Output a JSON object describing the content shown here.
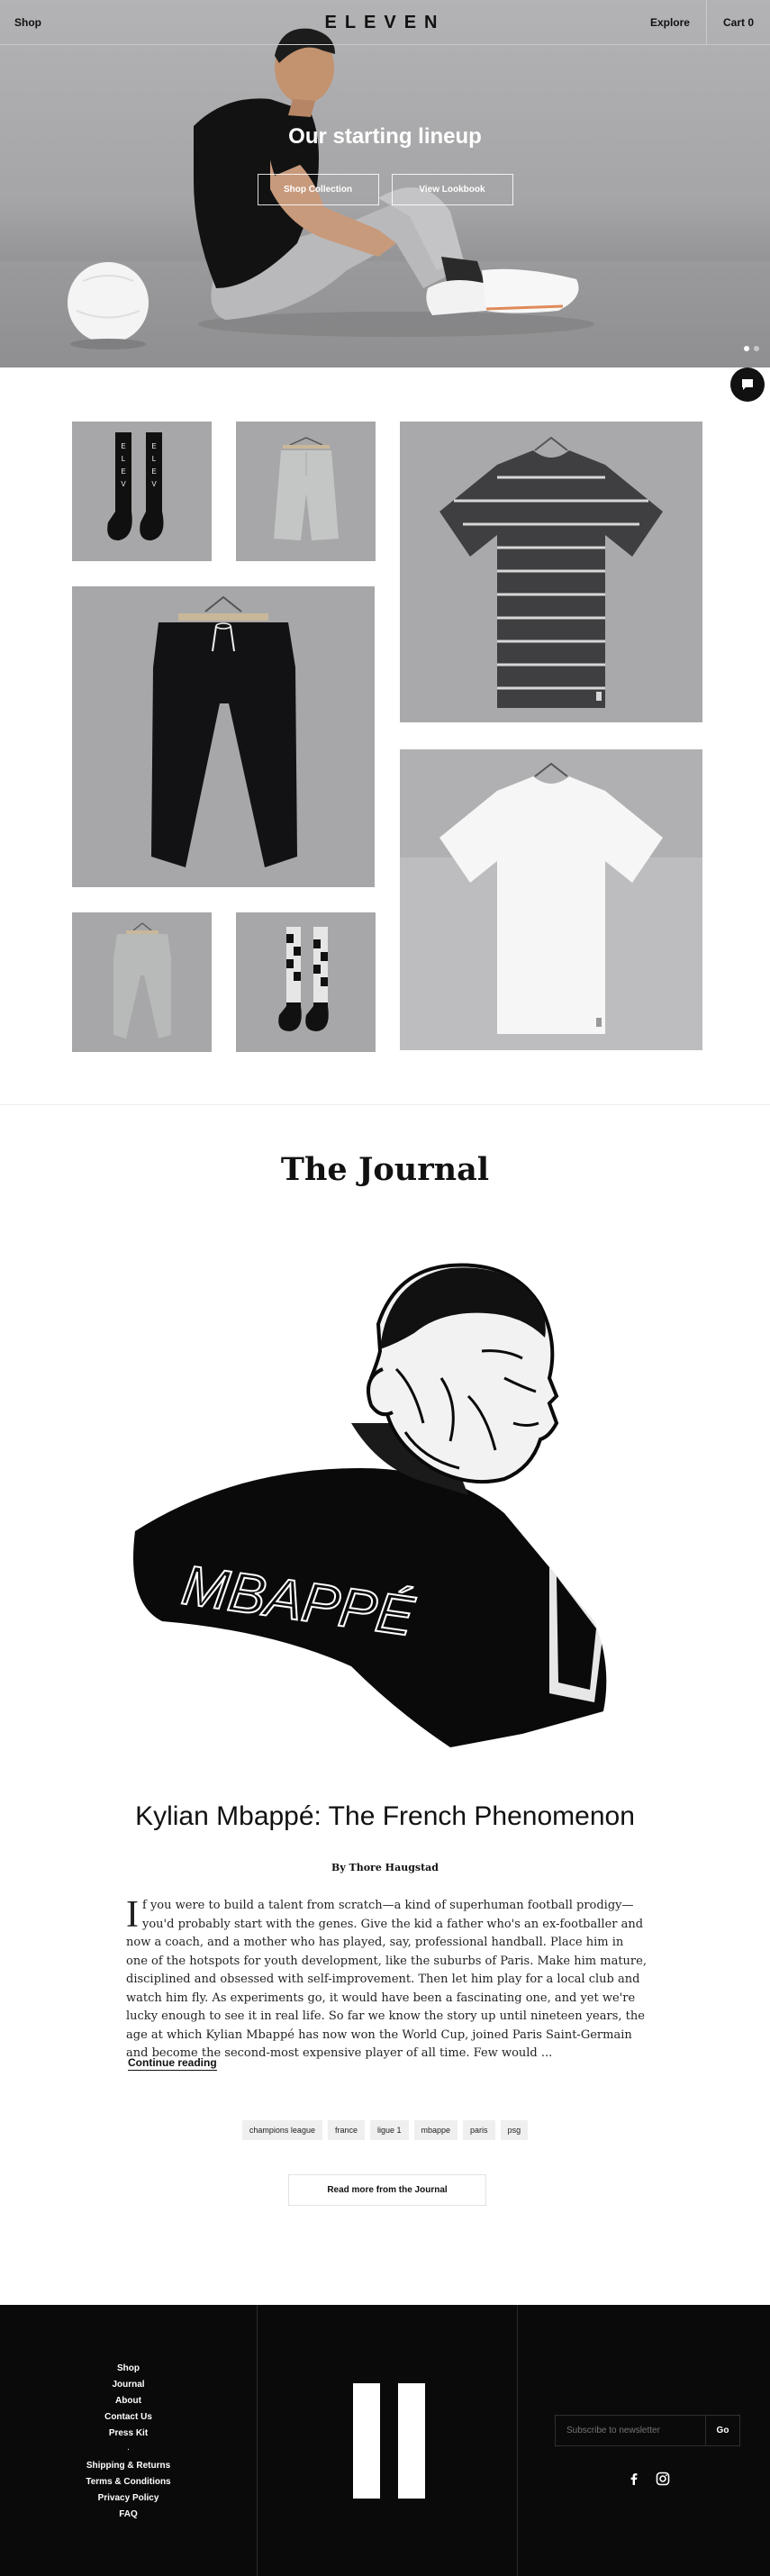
{
  "header": {
    "shop_label": "Shop",
    "logo_text": "ELEVEN",
    "explore_label": "Explore",
    "cart_label": "Cart 0"
  },
  "hero": {
    "title": "Our starting lineup",
    "shop_button": "Shop Collection",
    "lookbook_button": "View Lookbook",
    "slide_count": 2,
    "active_slide": 1
  },
  "products": [
    {
      "name": "Eleven socks black"
    },
    {
      "name": "Grey shorts"
    },
    {
      "name": "Striped t-shirt"
    },
    {
      "name": "Black joggers"
    },
    {
      "name": "White t-shirt"
    },
    {
      "name": "Grey joggers"
    },
    {
      "name": "Pixel socks"
    }
  ],
  "journal": {
    "heading": "The Journal",
    "illustration_text": "MBAPPÉ",
    "article_title": "Kylian Mbappé: The French Phenomenon",
    "byline": "By Thore Haugstad",
    "excerpt_first_letter": "I",
    "excerpt_rest": "f you were to build a talent from scratch—a kind of superhuman football prodigy—you'd probably start with the genes. Give the kid a father who's an ex-footballer and now a coach, and a mother who has played, say, professional handball. Place him in one of the hotspots for youth development, like the suburbs of Paris. Make him mature, disciplined and obsessed with self-improvement. Then let him play for a local club and watch him fly. As experiments go, it would have been a fascinating one, and yet we're lucky enough to see it in real life. So far we know the story up until nineteen years, the age at which Kylian Mbappé has now won the World Cup, joined Paris Saint-Germain and become the second-most expensive player of all time. Few would ...",
    "continue_label": "Continue reading",
    "tags": [
      "champions league",
      "france",
      "ligue 1",
      "mbappe",
      "paris",
      "psg"
    ],
    "read_more_label": "Read more from the Journal"
  },
  "footer": {
    "links": [
      "Shop",
      "Journal",
      "About",
      "Contact Us",
      "Press Kit"
    ],
    "separator": "·",
    "links2": [
      "Shipping & Returns",
      "Terms & Conditions",
      "Privacy Policy",
      "FAQ"
    ],
    "newsletter_placeholder": "Subscribe to newsletter",
    "newsletter_button": "Go",
    "socials": [
      "facebook-icon",
      "instagram-icon"
    ]
  },
  "colors": {
    "background": "#ffffff",
    "footer": "#0a0a0a",
    "hero": "#a6a6a8",
    "tile": "#a7a7a9",
    "tag": "#efefef"
  }
}
